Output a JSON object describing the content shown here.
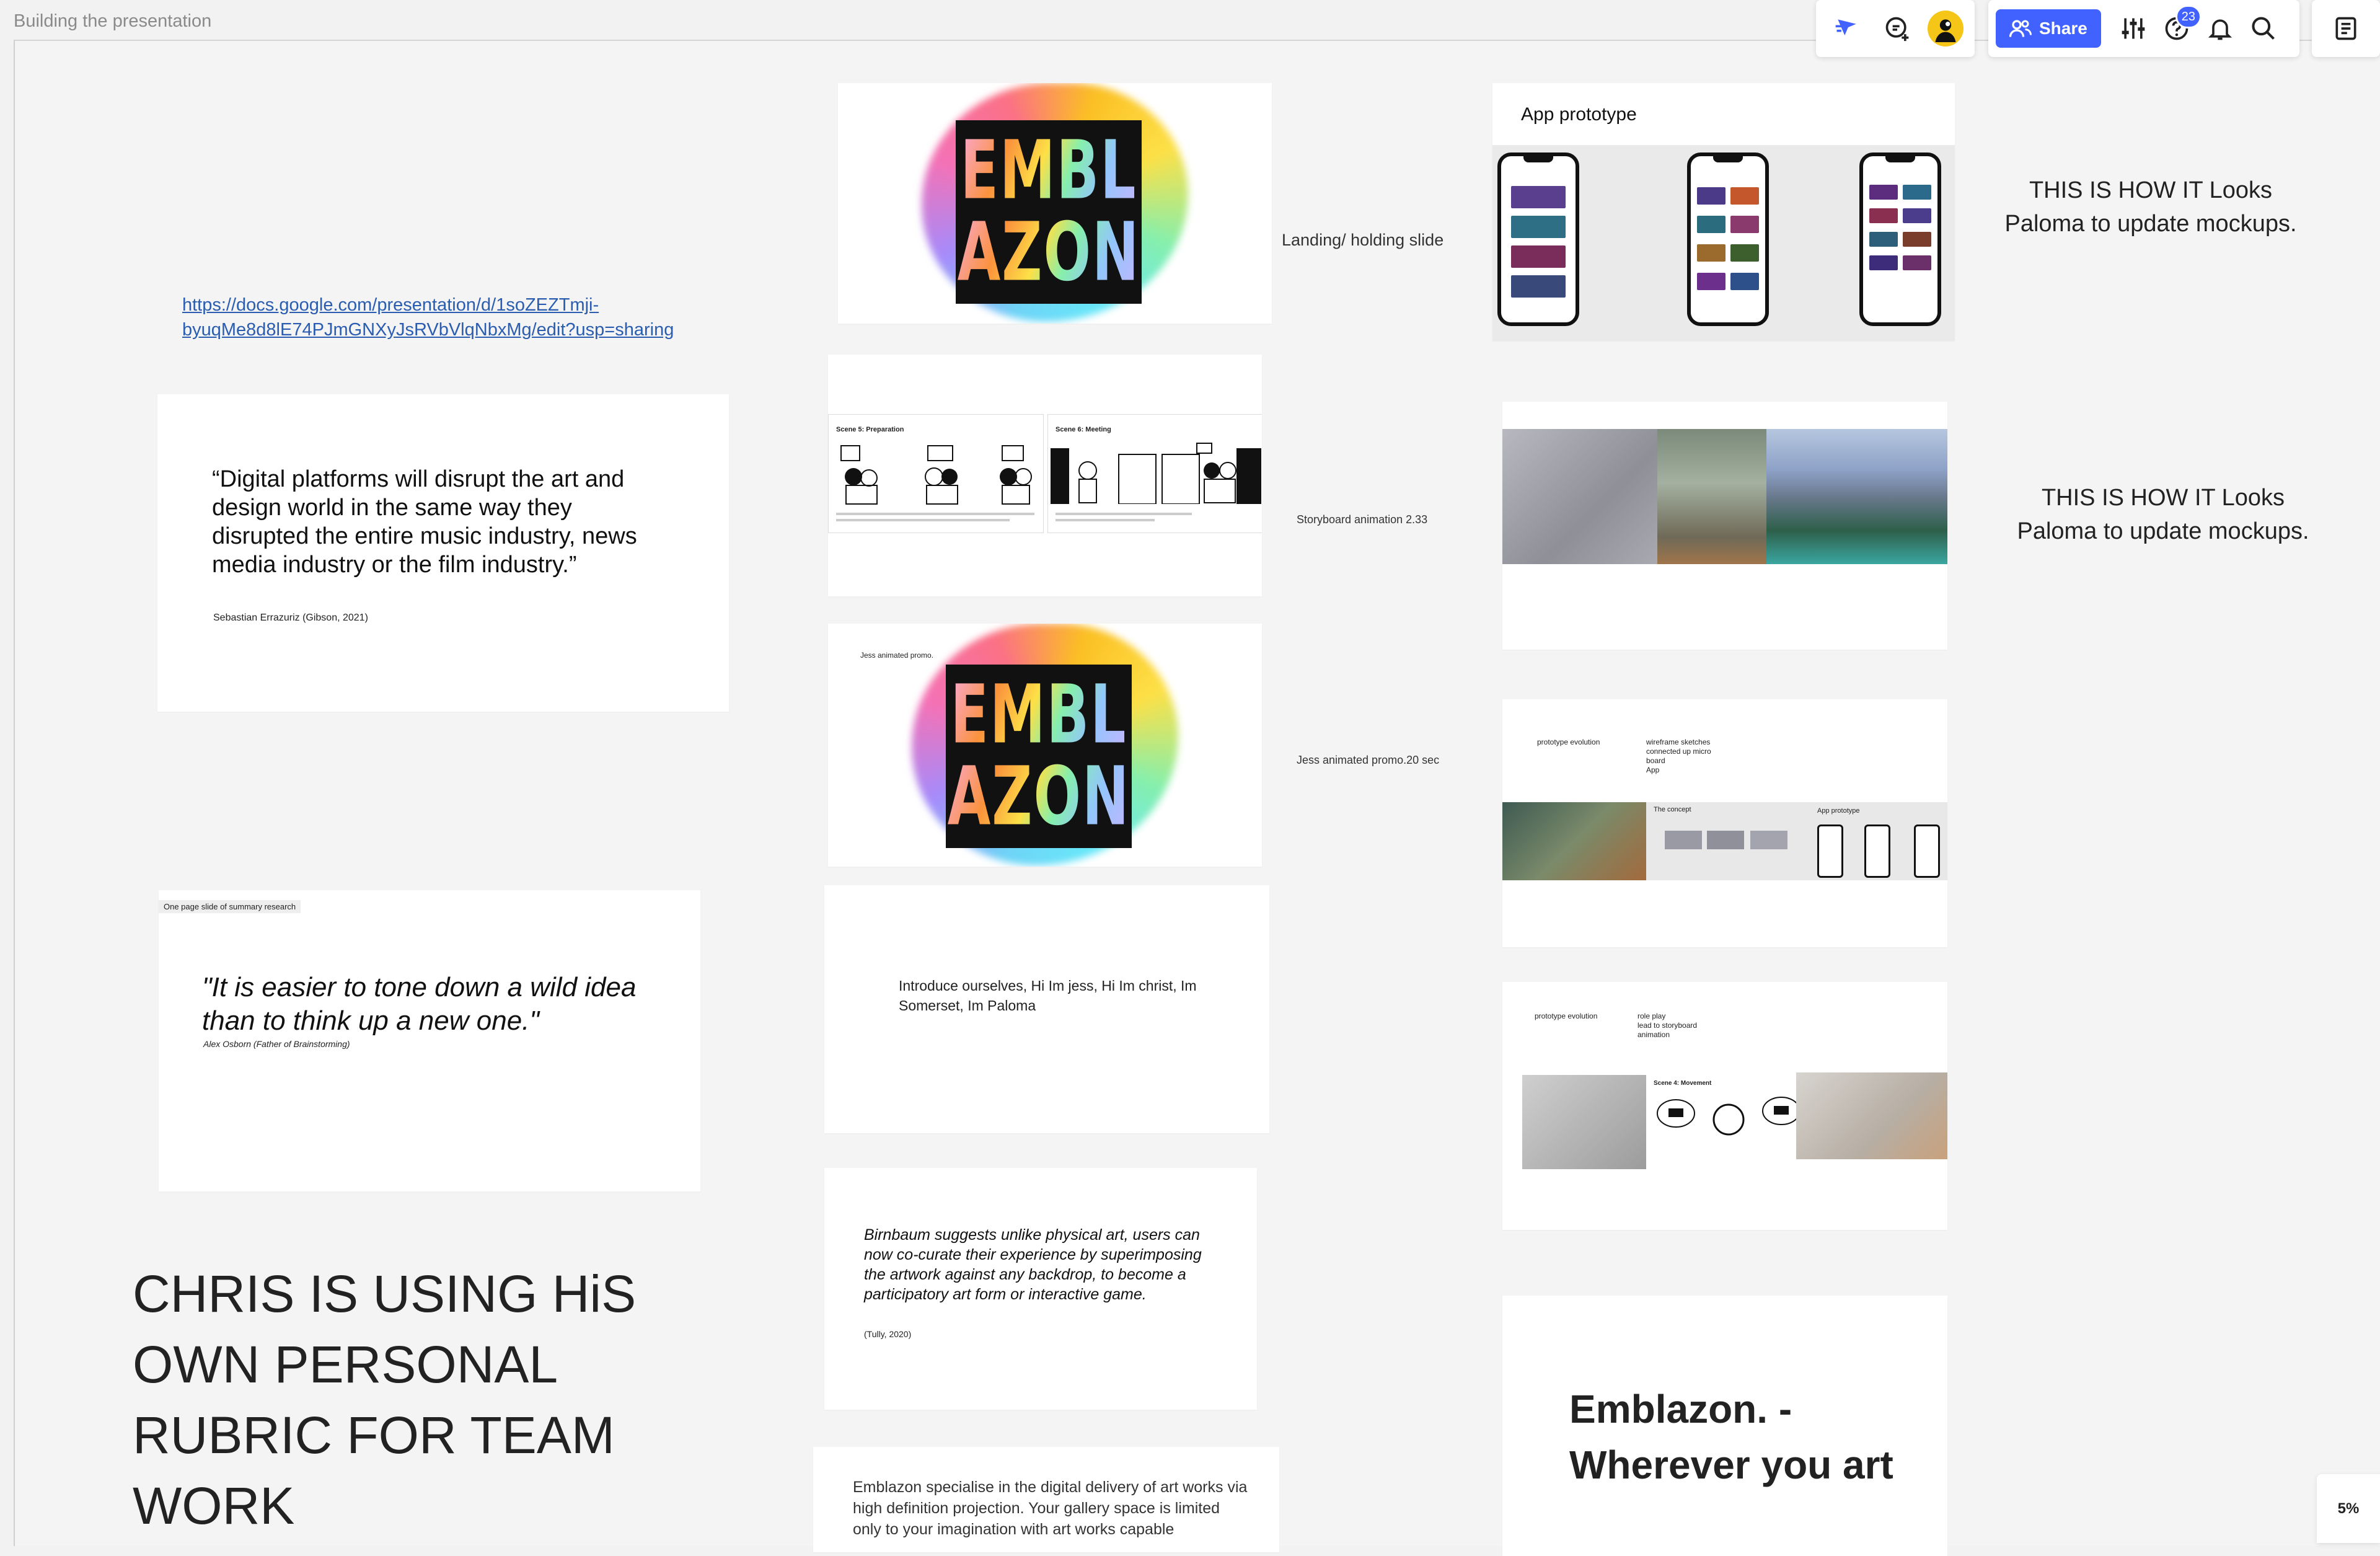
{
  "board": {
    "title": "Building the presentation",
    "zoom": "5%"
  },
  "toolbar": {
    "share_label": "Share",
    "help_badge": "23",
    "icons": [
      "cursor-icon",
      "comment-icon",
      "avatar",
      "share-people-icon",
      "settings-sliders-icon",
      "help-icon",
      "bell-icon",
      "search-icon",
      "notes-icon"
    ]
  },
  "link": {
    "line1": "https://docs.google.com/presentation/d/1soZEZTmji-",
    "line2": "byuqMe8d8lE74PJmGNXyJsRVbVlqNbxMg/edit?usp=sharing"
  },
  "quote1": {
    "text": "“Digital platforms will disrupt the art and design world in the same way they disrupted the entire music industry, news media industry or the film industry.”",
    "author": "Sebastian Errazuriz (Gibson, 2021)"
  },
  "quote2": {
    "tag": "One page slide of summary research",
    "text": "\"It is easier to tone down a wild idea than to think up a new one.\"",
    "author": "Alex Osborn (Father of Brainstorming)"
  },
  "chris_note": "CHRIS IS USING HiS OWN PERSONAL RUBRIC FOR TEAM WORK",
  "logo": {
    "line1": "EMBL",
    "line2": "AZON"
  },
  "labels": {
    "landing": "Landing/ holding slide",
    "storyboard": "Storyboard animation 2.33",
    "promo": "Jess animated promo.20 sec"
  },
  "storyboard": {
    "scene5": "Scene 5: Preparation",
    "scene6": "Scene 6: Meeting"
  },
  "promo_slide": {
    "caption": "Jess animated promo."
  },
  "intro_slide": {
    "text": "Introduce ourselves, Hi Im jess, Hi Im christ, Im Somerset, Im Paloma"
  },
  "birnbaum_slide": {
    "text": "Birnbaum suggests unlike physical art, users can now co-curate their experience by superimposing the artwork against any backdrop, to become a participatory art form or interactive game.",
    "cite": "(Tully, 2020)"
  },
  "emblazon_desc": {
    "text": "Emblazon specialise in the digital delivery of art works via high definition projection. Your gallery space is limited only to your imagination with art works capable"
  },
  "app_prototype": {
    "title": "App prototype"
  },
  "how_it_looks_1": {
    "line1": "THIS IS HOW IT Looks",
    "line2": "Paloma to update mockups."
  },
  "how_it_looks_2": {
    "line1": "THIS IS HOW IT Looks",
    "line2": "Paloma to update mockups."
  },
  "evolution1": {
    "label": "prototype evolution",
    "notes": [
      "wireframe sketches",
      "connected up micro",
      "board",
      "App"
    ],
    "concept": "The concept",
    "app_proto": "App prototype"
  },
  "evolution2": {
    "label": "prototype evolution",
    "notes": [
      "role play",
      "lead to storyboard",
      "animation"
    ],
    "scene": "Scene 4: Movement"
  },
  "tagline": {
    "line1": "Emblazon. -",
    "line2": "Wherever you art"
  },
  "colors": {
    "accent": "#4262ff",
    "board_bg": "#f2f2f2"
  }
}
